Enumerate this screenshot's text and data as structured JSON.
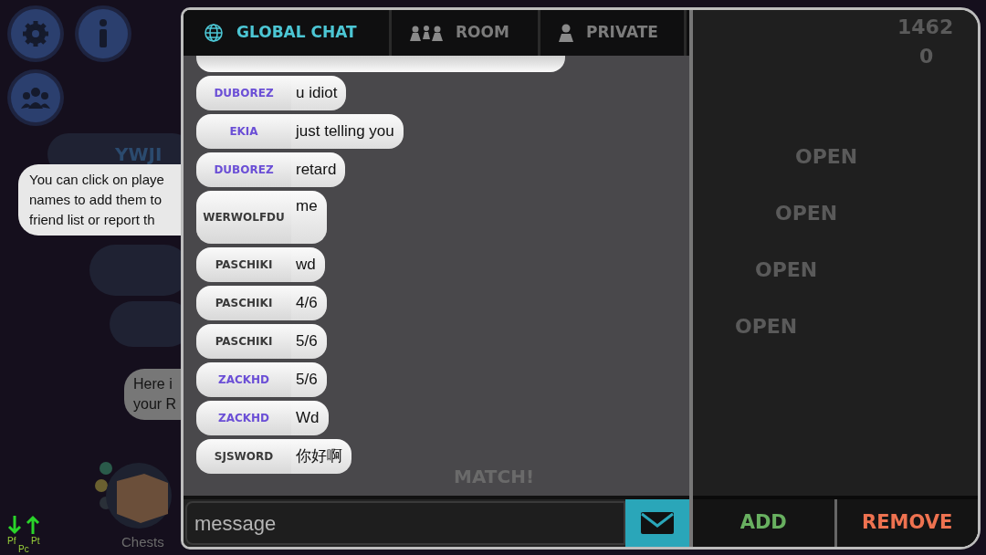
{
  "background": {
    "score": "1462",
    "coins": "0",
    "player_name": "YWJI",
    "tooltip": "You can click on playe\nnames to add them to\nfriend list or report th",
    "hint": "Here i\nyour R",
    "open_buttons": [
      "OPEN",
      "OPEN",
      "OPEN",
      "OPEN"
    ],
    "match_button": "MATCH!",
    "chests_label": "Chests",
    "debug_labels": [
      "Pf",
      "Pc",
      "Pt"
    ]
  },
  "chat": {
    "tabs": [
      {
        "label": "GLOBAL CHAT",
        "selected": true
      },
      {
        "label": "ROOM",
        "selected": false
      },
      {
        "label": "PRIVATE",
        "selected": false
      }
    ],
    "messages": [
      {
        "name": "DUBOREZ",
        "text": "u idiot",
        "color": "#6b4fd6",
        "tall": false
      },
      {
        "name": "EKIA",
        "text": "just telling you",
        "color": "#6b4fd6",
        "tall": false
      },
      {
        "name": "DUBOREZ",
        "text": "retard",
        "color": "#6b4fd6",
        "tall": false
      },
      {
        "name": "WERWOLFDU",
        "text": "me",
        "color": "#3a3a3a",
        "tall": true
      },
      {
        "name": "PASCHIKI",
        "text": "wd",
        "color": "#3a3a3a",
        "tall": false
      },
      {
        "name": "PASCHIKI",
        "text": "4/6",
        "color": "#3a3a3a",
        "tall": false
      },
      {
        "name": "PASCHIKI",
        "text": "5/6",
        "color": "#3a3a3a",
        "tall": false
      },
      {
        "name": "ZACKHD",
        "text": "5/6",
        "color": "#6b4fd6",
        "tall": false
      },
      {
        "name": "ZACKHD",
        "text": "Wd",
        "color": "#6b4fd6",
        "tall": false
      },
      {
        "name": "SJSWORD",
        "text": "你好啊",
        "color": "#3a3a3a",
        "tall": false
      }
    ],
    "input": {
      "placeholder": "message"
    },
    "add_button": "ADD",
    "remove_button": "REMOVE"
  }
}
